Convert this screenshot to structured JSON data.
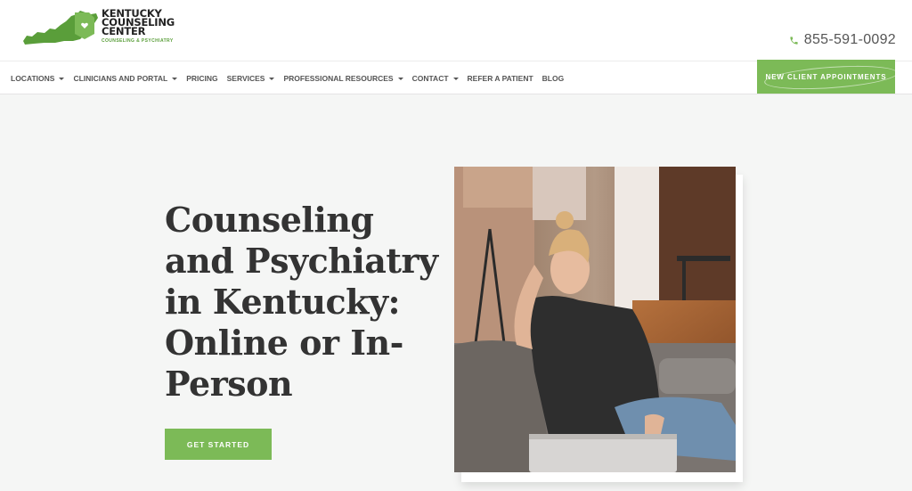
{
  "brand": {
    "line1": "KENTUCKY",
    "line2": "COUNSELING",
    "line3": "CENTER",
    "tagline": "COUNSELING & PSYCHIATRY"
  },
  "phone": "855-591-0092",
  "nav": {
    "items": [
      {
        "label": "LOCATIONS",
        "dropdown": true
      },
      {
        "label": "CLINICIANS AND PORTAL",
        "dropdown": true
      },
      {
        "label": "PRICING",
        "dropdown": false
      },
      {
        "label": "SERVICES",
        "dropdown": true
      },
      {
        "label": "PROFESSIONAL RESOURCES",
        "dropdown": true
      },
      {
        "label": "CONTACT",
        "dropdown": true
      },
      {
        "label": "REFER A PATIENT",
        "dropdown": false
      },
      {
        "label": "BLOG",
        "dropdown": false
      }
    ],
    "cta": "NEW CLIENT APPOINTMENTS"
  },
  "hero": {
    "title": "Counseling and Psychiatry in Kentucky: Online or In-Person",
    "button": "GET STARTED"
  },
  "colors": {
    "brand_green": "#7cba57",
    "logo_green": "#5a9e3a",
    "text_dark": "#333333"
  }
}
